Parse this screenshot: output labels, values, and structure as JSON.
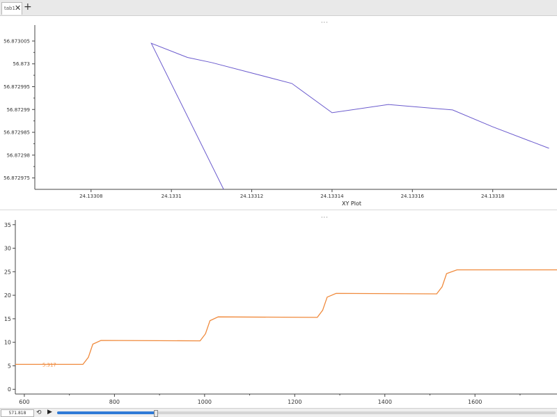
{
  "tab": {
    "label": "tab1",
    "close_glyph": "✕",
    "add_glyph": "+"
  },
  "panels": {
    "handle_glyph": "···"
  },
  "playback": {
    "time": "571.818",
    "progress": 0.197
  },
  "colors": {
    "xy_line": "#6a5acd",
    "ts_line": "#f08a3c",
    "axis": "#444444"
  },
  "chart_data": [
    {
      "type": "line",
      "title": "XY Plot",
      "xlabel": "",
      "ylabel": "",
      "xlim": [
        24.133066,
        24.133196
      ],
      "ylim": [
        56.8729725,
        56.8730085
      ],
      "xticks": [
        "24.13308",
        "24.1331",
        "24.13312",
        "24.13314",
        "24.13316",
        "24.13318"
      ],
      "yticks": [
        "56.873005",
        "56.873",
        "56.872995",
        "56.87299",
        "56.872985",
        "56.87298",
        "56.872975"
      ],
      "series": [
        {
          "x": [
            24.133113,
            24.133095,
            24.133104,
            24.13311,
            24.13313,
            24.13314,
            24.133154,
            24.13317,
            24.13318,
            24.133194
          ],
          "y": [
            56.8729725,
            56.8730045,
            56.8730014,
            56.8730003,
            56.8729957,
            56.8729893,
            56.8729911,
            56.8729899,
            56.8729862,
            56.8729815
          ]
        }
      ]
    },
    {
      "type": "line",
      "title": "",
      "xlabel": "",
      "ylabel": "",
      "xlim": [
        580,
        1782
      ],
      "ylim": [
        -1,
        36
      ],
      "xticks": [
        600,
        800,
        1000,
        1200,
        1400,
        1600
      ],
      "yticks": [
        0,
        5,
        10,
        15,
        20,
        25,
        30,
        35
      ],
      "annotation": {
        "text": "5.317",
        "x": 640,
        "y": 5.3
      },
      "series": [
        {
          "x": [
            580,
            730,
            742,
            752,
            770,
            990,
            1002,
            1012,
            1030,
            1250,
            1262,
            1272,
            1292,
            1515,
            1527,
            1537,
            1560,
            1782
          ],
          "y": [
            5.3,
            5.3,
            6.8,
            9.6,
            10.4,
            10.3,
            11.8,
            14.6,
            15.4,
            15.3,
            16.8,
            19.6,
            20.4,
            20.3,
            21.8,
            24.6,
            25.4,
            25.4
          ]
        }
      ]
    }
  ]
}
